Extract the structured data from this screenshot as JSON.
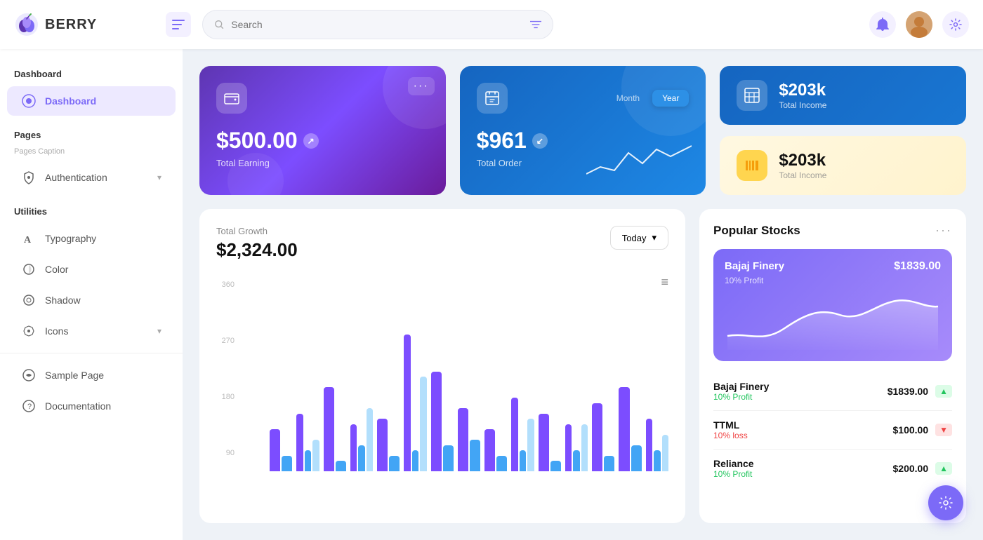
{
  "app": {
    "name": "BERRY",
    "logo_emoji": "🫐"
  },
  "topbar": {
    "menu_icon": "☰",
    "search_placeholder": "Search",
    "filter_icon": "⚙",
    "bell_icon": "🔔",
    "settings_icon": "⚙",
    "avatar_emoji": "👤"
  },
  "sidebar": {
    "sections": [
      {
        "title": "Dashboard",
        "items": [
          {
            "label": "Dashboard",
            "icon": "◎",
            "active": true
          }
        ]
      },
      {
        "title": "Pages",
        "subtitle": "Pages Caption",
        "items": [
          {
            "label": "Authentication",
            "icon": "🔑",
            "has_chevron": true
          }
        ]
      },
      {
        "title": "Utilities",
        "items": [
          {
            "label": "Typography",
            "icon": "A"
          },
          {
            "label": "Color",
            "icon": "◑"
          },
          {
            "label": "Shadow",
            "icon": "⊙"
          },
          {
            "label": "Icons",
            "icon": "✦",
            "has_chevron": true
          }
        ]
      },
      {
        "title": "",
        "items": [
          {
            "label": "Sample Page",
            "icon": "◎"
          },
          {
            "label": "Documentation",
            "icon": "?"
          }
        ]
      }
    ]
  },
  "cards": {
    "earning": {
      "amount": "$500.00",
      "label": "Total Earning",
      "menu": "···"
    },
    "order": {
      "amount": "$961",
      "label": "Total Order",
      "tabs": [
        "Month",
        "Year"
      ],
      "active_tab": "Year"
    },
    "stat1": {
      "amount": "$203k",
      "label": "Total Income",
      "icon": "▦"
    },
    "stat2": {
      "amount": "$203k",
      "label": "Total Income",
      "icon": "▦"
    }
  },
  "growth": {
    "title": "Total Growth",
    "amount": "$2,324.00",
    "period_btn": "Today",
    "y_labels": [
      "360",
      "270",
      "180",
      "90"
    ],
    "bars": [
      {
        "purple": 40,
        "blue": 15,
        "light": 0
      },
      {
        "purple": 55,
        "blue": 20,
        "light": 30
      },
      {
        "purple": 80,
        "blue": 10,
        "light": 0
      },
      {
        "purple": 45,
        "blue": 25,
        "light": 60
      },
      {
        "purple": 50,
        "blue": 15,
        "light": 0
      },
      {
        "purple": 130,
        "blue": 20,
        "light": 90
      },
      {
        "purple": 95,
        "blue": 25,
        "light": 0
      },
      {
        "purple": 60,
        "blue": 30,
        "light": 0
      },
      {
        "purple": 40,
        "blue": 15,
        "light": 0
      },
      {
        "purple": 70,
        "blue": 20,
        "light": 50
      },
      {
        "purple": 55,
        "blue": 10,
        "light": 0
      },
      {
        "purple": 45,
        "blue": 20,
        "light": 45
      },
      {
        "purple": 65,
        "blue": 15,
        "light": 0
      },
      {
        "purple": 80,
        "blue": 25,
        "light": 0
      },
      {
        "purple": 50,
        "blue": 20,
        "light": 35
      }
    ]
  },
  "stocks": {
    "title": "Popular Stocks",
    "hero": {
      "name": "Bajaj Finery",
      "price": "$1839.00",
      "change": "10% Profit"
    },
    "list": [
      {
        "name": "Bajaj Finery",
        "price": "$1839.00",
        "change": "10% Profit",
        "direction": "up"
      },
      {
        "name": "TTML",
        "price": "$100.00",
        "change": "10% loss",
        "direction": "down"
      },
      {
        "name": "Reliance",
        "price": "$200.00",
        "change": "10% Profit",
        "direction": "up"
      }
    ]
  },
  "fab": {
    "icon": "⚙"
  }
}
